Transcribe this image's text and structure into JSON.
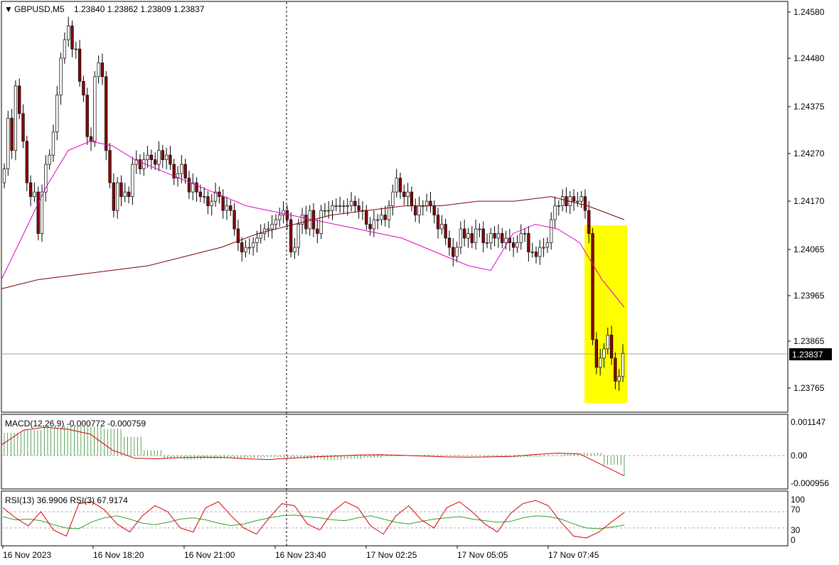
{
  "header": {
    "symbol": "GBPUSD,M5",
    "ohlc": "1.23840 1.23862 1.23809 1.23837"
  },
  "colors": {
    "background": "#ffffff",
    "bull_candle": "#2e8b2e",
    "bear_candle": "#8b0000",
    "ma_fast": "#e000c8",
    "ma_slow": "#800000",
    "highlight": "#ffff00",
    "macd_hist": "#2e8b2e",
    "macd_signal": "#d40000",
    "rsi13": "#2ca02c",
    "rsi3": "#d40000",
    "price_tag_bg": "#000000"
  },
  "price_axis": {
    "ticks": [
      "1.24580",
      "1.24480",
      "1.24375",
      "1.24270",
      "1.24170",
      "1.24065",
      "1.23965",
      "1.23865",
      "1.23765"
    ],
    "current_price": "1.23837"
  },
  "time_axis": {
    "ticks": [
      "16 Nov 2023",
      "16 Nov 18:20",
      "16 Nov 21:00",
      "16 Nov 23:40",
      "17 Nov 02:25",
      "17 Nov 05:05",
      "17 Nov 07:45"
    ]
  },
  "macd": {
    "label": "MACD(12,26,9) -0.000772 -0.000759",
    "ticks": [
      "0.001147",
      "0.00",
      "-0.000956"
    ]
  },
  "rsi": {
    "label": "RSI(13) 36.9906  RSI(3) 67.9174",
    "ticks": [
      "100",
      "70",
      "30",
      "0"
    ]
  },
  "chart_data": {
    "type": "line",
    "title": "GBPUSD,M5",
    "ylim": [
      1.2372,
      1.2461
    ],
    "series": [
      {
        "name": "GBPUSD,M5",
        "values": [
          1.2424,
          1.2435,
          1.2428,
          1.2442,
          1.2436,
          1.243,
          1.2421,
          1.2418,
          1.2419,
          1.241,
          1.2419,
          1.2425,
          1.2427,
          1.2432,
          1.244,
          1.2448,
          1.2452,
          1.2455,
          1.245,
          1.245,
          1.2443,
          1.244,
          1.2431,
          1.243,
          1.2444,
          1.2447,
          1.2444,
          1.2428,
          1.2421,
          1.2415,
          1.2421,
          1.2418,
          1.2419,
          1.2418,
          1.2425,
          1.2426,
          1.2424,
          1.2426,
          1.2427,
          1.2426,
          1.2425,
          1.2428,
          1.2426,
          1.2427,
          1.2425,
          1.2422,
          1.2423,
          1.2425,
          1.2422,
          1.2419,
          1.2421,
          1.2419,
          1.2418,
          1.2418,
          1.2416,
          1.2417,
          1.2419,
          1.2418,
          1.2415,
          1.2416,
          1.2415,
          1.2411,
          1.2408,
          1.2406,
          1.2407,
          1.2407,
          1.2408,
          1.2409,
          1.241,
          1.2411,
          1.2411,
          1.2412,
          1.2413,
          1.2414,
          1.2415,
          1.2413,
          1.2406,
          1.2407,
          1.2412,
          1.2414,
          1.2411,
          1.2415,
          1.2411,
          1.241,
          1.2415,
          1.2415,
          1.2415,
          1.2416,
          1.2416,
          1.2416,
          1.2416,
          1.2416,
          1.2417,
          1.2416,
          1.2415,
          1.2415,
          1.2412,
          1.2411,
          1.2413,
          1.2413,
          1.2414,
          1.2413,
          1.2416,
          1.2419,
          1.2422,
          1.2419,
          1.2418,
          1.2419,
          1.2416,
          1.2414,
          1.2416,
          1.2416,
          1.2417,
          1.2416,
          1.2414,
          1.2411,
          1.2412,
          1.2409,
          1.2407,
          1.2405,
          1.2407,
          1.2411,
          1.2409,
          1.241,
          1.2408,
          1.2411,
          1.2411,
          1.2408,
          1.2408,
          1.241,
          1.2409,
          1.241,
          1.2408,
          1.2409,
          1.2408,
          1.2407,
          1.2408,
          1.241,
          1.241,
          1.2406,
          1.2406,
          1.2405,
          1.2407,
          1.2407,
          1.2408,
          1.2413,
          1.2416,
          1.2416,
          1.2418,
          1.2416,
          1.2418,
          1.2417,
          1.2417,
          1.2418,
          1.2415,
          1.241,
          1.2387,
          1.2381,
          1.2383,
          1.2385,
          1.2388,
          1.2383,
          1.2378,
          1.2379,
          1.2384
        ]
      },
      {
        "name": "MA fast",
        "values": [
          1.24,
          1.241,
          1.242,
          1.2428,
          1.243,
          1.2429,
          1.2426,
          1.2424,
          1.2422,
          1.242,
          1.2418,
          1.2416,
          1.2415,
          1.2414,
          1.2413,
          1.2412,
          1.2411,
          1.241,
          1.2409,
          1.2407,
          1.2405,
          1.2403,
          1.2402,
          1.241,
          1.2412,
          1.2411,
          1.2408,
          1.24,
          1.2394
        ]
      },
      {
        "name": "MA slow",
        "values": [
          1.2398,
          1.24,
          1.2401,
          1.2402,
          1.2403,
          1.2405,
          1.2407,
          1.241,
          1.2412,
          1.2414,
          1.2415,
          1.2416,
          1.2416,
          1.2417,
          1.2417,
          1.2418,
          1.2416,
          1.2413
        ]
      }
    ],
    "macd_hist": [
      0.00085,
      0.00095,
      0.00105,
      0.0011,
      0.00108,
      0.001,
      0.0007,
      0.0002,
      -0.0001,
      -0.00015,
      -0.00012,
      -0.0001,
      -8e-05,
      -6e-05,
      -9e-05,
      -0.00013,
      -0.00017,
      -0.00013,
      -8e-05,
      -3e-05,
      1e-05,
      3e-05,
      2e-05,
      -1e-05,
      -4e-05,
      -6e-05,
      -5e-05,
      -3e-05,
      6e-05,
      0.0001,
      -0.00035,
      -0.00077
    ],
    "macd_signal": [
      0.0004,
      0.00095,
      0.00106,
      0.00098,
      0.0008,
      0.0002,
      -0.0001,
      -0.00012,
      -8e-05,
      -6e-05,
      -7e-05,
      -0.00012,
      -0.00015,
      -0.0001,
      -5e-05,
      -2e-05,
      2e-05,
      3e-05,
      1e-05,
      -2e-05,
      -5e-05,
      -6e-05,
      -5e-05,
      -3e-05,
      4e-05,
      9e-05,
      6e-05,
      -0.00035,
      -0.00076
    ],
    "rsi13": [
      58,
      50,
      52,
      48,
      38,
      30,
      28,
      45,
      55,
      60,
      52,
      42,
      38,
      44,
      52,
      55,
      50,
      42,
      36,
      40,
      48,
      55,
      60,
      62,
      58,
      55,
      50,
      48,
      55,
      60,
      52,
      44,
      40,
      46,
      52,
      55,
      58,
      52,
      48,
      44,
      46,
      55,
      60,
      58,
      52,
      40,
      30,
      28,
      32,
      37
    ],
    "rsi3": [
      80,
      55,
      35,
      70,
      25,
      10,
      90,
      95,
      75,
      40,
      20,
      60,
      85,
      70,
      30,
      20,
      80,
      95,
      60,
      30,
      15,
      55,
      90,
      85,
      40,
      25,
      70,
      95,
      80,
      35,
      15,
      60,
      85,
      50,
      30,
      80,
      95,
      70,
      40,
      20,
      65,
      90,
      98,
      85,
      45,
      10,
      5,
      20,
      45,
      68
    ]
  }
}
